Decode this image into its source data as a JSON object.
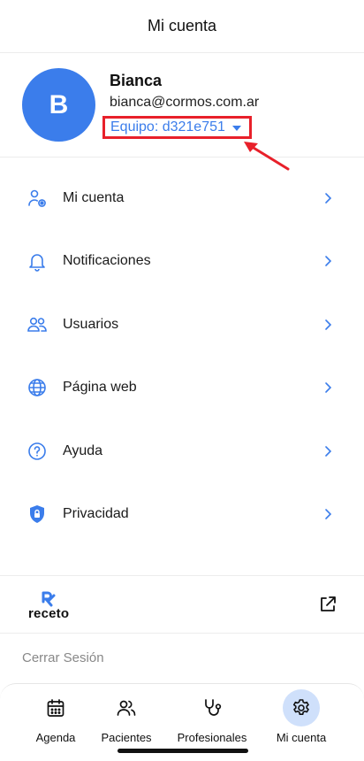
{
  "header": {
    "title": "Mi cuenta"
  },
  "profile": {
    "avatar_initial": "B",
    "name": "Bianca",
    "email": "bianca@cormos.com.ar",
    "team_label": "Equipo: d321e751"
  },
  "menu": {
    "items": [
      {
        "label": "Mi cuenta",
        "icon": "user-gear-icon"
      },
      {
        "label": "Notificaciones",
        "icon": "bell-icon"
      },
      {
        "label": "Usuarios",
        "icon": "users-icon"
      },
      {
        "label": "Página web",
        "icon": "globe-icon"
      },
      {
        "label": "Ayuda",
        "icon": "help-circle-icon"
      },
      {
        "label": "Privacidad",
        "icon": "shield-lock-icon"
      }
    ]
  },
  "brand": {
    "name": "receto",
    "icon": "external-link-icon"
  },
  "logout": {
    "label": "Cerrar Sesión"
  },
  "bottom_nav": {
    "items": [
      {
        "label": "Agenda",
        "icon": "calendar-icon"
      },
      {
        "label": "Pacientes",
        "icon": "patients-icon"
      },
      {
        "label": "Profesionales",
        "icon": "stethoscope-icon"
      },
      {
        "label": "Mi cuenta",
        "icon": "gear-icon",
        "active": true
      }
    ]
  },
  "colors": {
    "accent": "#3b7deb",
    "highlight_box": "#e8202a",
    "active_nav_bg": "#cfe0fb"
  }
}
